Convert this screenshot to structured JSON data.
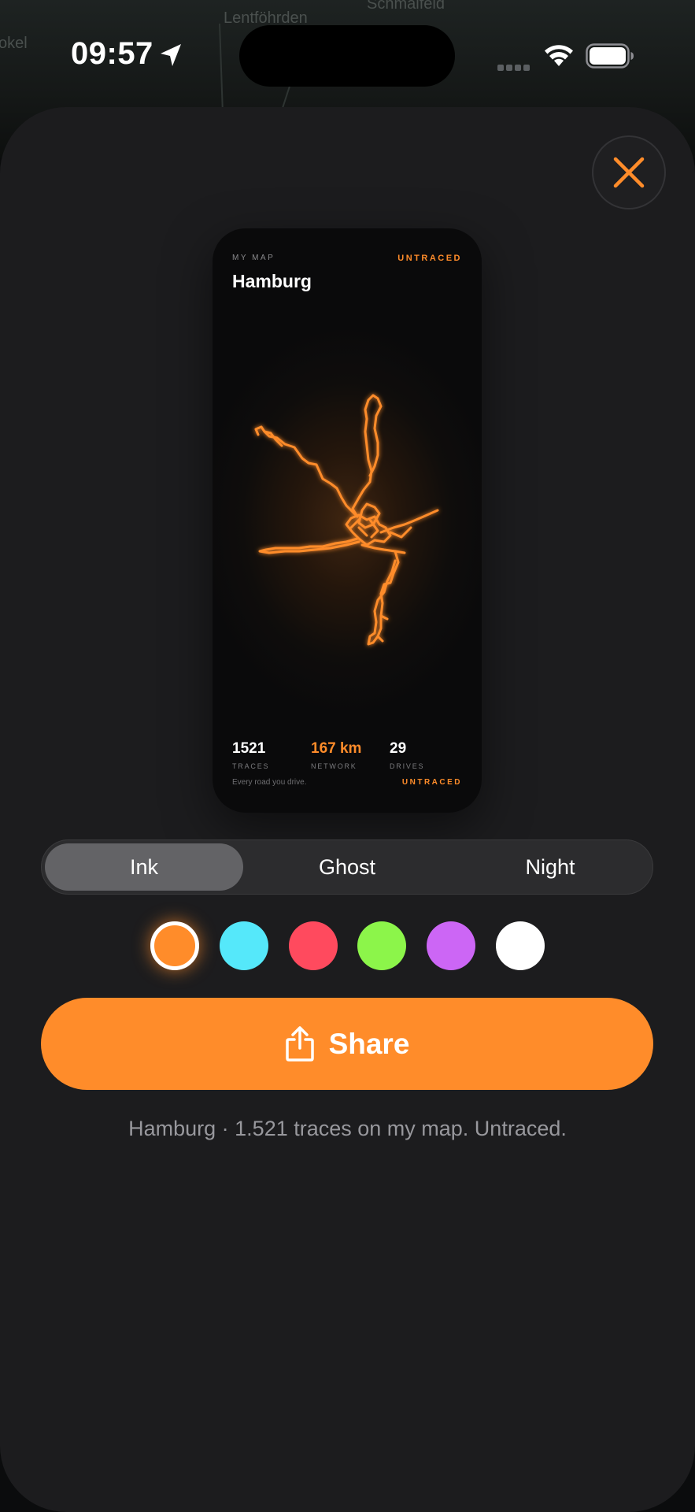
{
  "background_map": {
    "places": [
      "Lentföhrden",
      "Schmalfeld",
      "okel"
    ]
  },
  "status_bar": {
    "time": "09:57",
    "location_icon": "location-arrow-icon",
    "wifi_icon": "wifi-icon",
    "battery_icon": "battery-icon"
  },
  "close_button": {
    "icon": "close-icon",
    "color": "#ff8c2a"
  },
  "preview_card": {
    "kicker": "MY MAP",
    "brand": "UNTRACED",
    "city": "Hamburg",
    "stats": [
      {
        "value": "1521",
        "label": "TRACES",
        "accent": false
      },
      {
        "value": "167 km",
        "label": "NETWORK",
        "accent": true
      },
      {
        "value": "29",
        "label": "DRIVES",
        "accent": false
      }
    ],
    "tagline": "Every road you drive.",
    "brand_bottom": "UNTRACED",
    "trace_color": "#ff8c2a"
  },
  "style_picker": {
    "options": [
      "Ink",
      "Ghost",
      "Night"
    ],
    "selected": "Ink"
  },
  "color_picker": {
    "colors": [
      "#ff8c2a",
      "#55e8fa",
      "#ff4a5e",
      "#8cf54a",
      "#cc66f5",
      "#ffffff"
    ],
    "selected": "#ff8c2a"
  },
  "share_button": {
    "label": "Share",
    "icon": "share-icon"
  },
  "share_caption": "Hamburg · 1.521 traces on my map. Untraced.",
  "accent_color": "#ff8c2a"
}
